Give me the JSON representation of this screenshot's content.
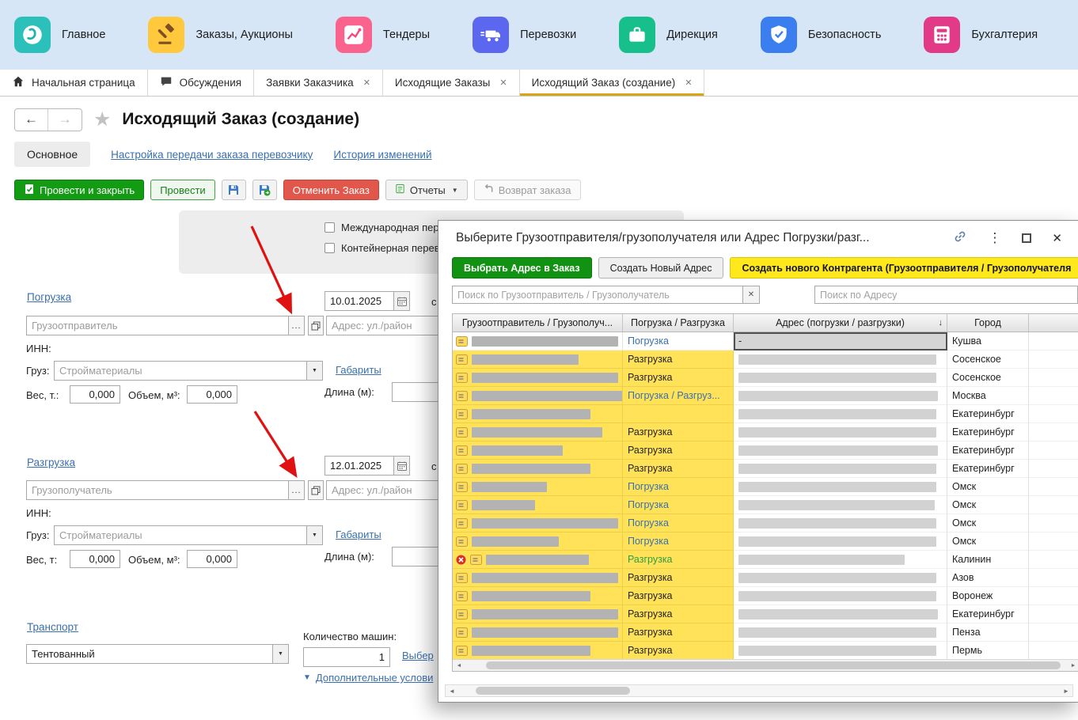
{
  "nav": {
    "items": [
      {
        "label": "Главное"
      },
      {
        "label": "Заказы, Аукционы"
      },
      {
        "label": "Тендеры"
      },
      {
        "label": "Перевозки"
      },
      {
        "label": "Дирекция"
      },
      {
        "label": "Безопасность"
      },
      {
        "label": "Бухгалтерия"
      }
    ]
  },
  "tabs": {
    "home": "Начальная страница",
    "discussions": "Обсуждения",
    "requests": "Заявки Заказчика",
    "outgoing": "Исходящие Заказы",
    "current": "Исходящий Заказ (создание)"
  },
  "page": {
    "title": "Исходящий Заказ (создание)"
  },
  "subtabs": {
    "main": "Основное",
    "transfer": "Настройка передачи заказа перевозчику",
    "history": "История изменений"
  },
  "toolbar": {
    "post_close": "Провести и закрыть",
    "post": "Провести",
    "cancel": "Отменить Заказ",
    "reports": "Отчеты",
    "return_order": "Возврат заказа"
  },
  "form": {
    "intl_checkbox": "Международная пер",
    "container_checkbox": "Контейнерная перев",
    "loading": {
      "title": "Погрузка",
      "date": "10.01.2025",
      "from": "с",
      "party_ph": "Грузоотправитель",
      "addr_ph": "Адрес: ул./район",
      "inn": "ИНН:",
      "cargo": "Груз:",
      "cargo_ph": "Стройматериалы",
      "dims": "Габариты",
      "len": "Длина (м):",
      "weight_l": "Вес, т.:",
      "weight": "0,000",
      "vol_l": "Объем, м³:",
      "vol": "0,000"
    },
    "unloading": {
      "title": "Разгрузка",
      "date": "12.01.2025",
      "from": "с",
      "party_ph": "Грузополучатель",
      "addr_ph": "Адрес: ул./район",
      "inn": "ИНН:",
      "cargo": "Груз:",
      "cargo_ph": "Стройматериалы",
      "dims": "Габариты",
      "len": "Длина (м):",
      "weight_l": "Вес, т:",
      "weight": "0,000",
      "vol_l": "Объем, м³:",
      "vol": "0,000"
    },
    "transport": {
      "title": "Транспорт",
      "value": "Тентованный",
      "qty_l": "Количество машин:",
      "qty": "1",
      "select": "Выбер",
      "more": "Дополнительные услови"
    }
  },
  "dialog": {
    "title": "Выберите Грузоотправителя/грузополучателя или Адрес Погрузки/разг...",
    "select_btn": "Выбрать Адрес в Заказ",
    "new_addr_btn": "Создать Новый Адрес",
    "new_party_btn": "Создать нового Контрагента (Грузоотправителя / Грузополучателя",
    "search_party_ph": "Поиск по Грузоотправитель / Грузополучатель",
    "search_addr_ph": "Поиск по Адресу",
    "columns": [
      "Грузоотправитель / Грузополуч...",
      "Погрузка / Разгрузка",
      "Адрес (погрузки / разгрузки)",
      "Город"
    ],
    "rows": [
      {
        "type": "Погрузка",
        "tstyle": "link",
        "city": "Кушва",
        "nw": 185,
        "aw": 0,
        "atext": "-",
        "yellow": false,
        "selcell": true,
        "del": false
      },
      {
        "type": "Разгрузка",
        "tstyle": "plain",
        "city": "Сосенское",
        "nw": 135,
        "aw": 250,
        "yellow": true,
        "del": false
      },
      {
        "type": "Разгрузка",
        "tstyle": "plain",
        "city": "Сосенское",
        "nw": 185,
        "aw": 250,
        "yellow": true,
        "del": false
      },
      {
        "type": "Погрузка / Разгруз...",
        "tstyle": "link",
        "city": "Москва",
        "nw": 205,
        "aw": 252,
        "yellow": true,
        "del": false
      },
      {
        "type": "",
        "tstyle": "plain",
        "city": "Екатеринбург",
        "nw": 150,
        "aw": 250,
        "yellow": true,
        "del": false
      },
      {
        "type": "Разгрузка",
        "tstyle": "plain",
        "city": "Екатеринбург",
        "nw": 165,
        "aw": 250,
        "yellow": true,
        "del": false
      },
      {
        "type": "Разгрузка",
        "tstyle": "plain",
        "city": "Екатеринбург",
        "nw": 115,
        "aw": 252,
        "yellow": true,
        "del": false
      },
      {
        "type": "Разгрузка",
        "tstyle": "plain",
        "city": "Екатеринбург",
        "nw": 150,
        "aw": 250,
        "yellow": true,
        "del": false
      },
      {
        "type": "Погрузка",
        "tstyle": "link",
        "city": "Омск",
        "nw": 95,
        "aw": 250,
        "yellow": true,
        "del": false
      },
      {
        "type": "Погрузка",
        "tstyle": "link",
        "city": "Омск",
        "nw": 80,
        "aw": 248,
        "yellow": true,
        "del": false
      },
      {
        "type": "Погрузка",
        "tstyle": "link",
        "city": "Омск",
        "nw": 185,
        "aw": 250,
        "yellow": true,
        "del": false
      },
      {
        "type": "Погрузка",
        "tstyle": "link",
        "city": "Омск",
        "nw": 110,
        "aw": 250,
        "yellow": true,
        "del": false
      },
      {
        "type": "Разгрузка",
        "tstyle": "green",
        "city": "Калинин",
        "nw": 130,
        "aw": 210,
        "yellow": true,
        "del": true
      },
      {
        "type": "Разгрузка",
        "tstyle": "plain",
        "city": "Азов",
        "nw": 185,
        "aw": 250,
        "yellow": true,
        "del": false
      },
      {
        "type": "Разгрузка",
        "tstyle": "plain",
        "city": "Воронеж",
        "nw": 150,
        "aw": 250,
        "yellow": true,
        "del": false
      },
      {
        "type": "Разгрузка",
        "tstyle": "plain",
        "city": "Екатеринбург",
        "nw": 185,
        "aw": 252,
        "yellow": true,
        "del": false
      },
      {
        "type": "Разгрузка",
        "tstyle": "plain",
        "city": "Пенза",
        "nw": 185,
        "aw": 250,
        "yellow": true,
        "del": false
      },
      {
        "type": "Разгрузка",
        "tstyle": "plain",
        "city": "Пермь",
        "nw": 150,
        "aw": 250,
        "yellow": true,
        "del": false
      }
    ]
  },
  "icons": {
    "back": "←",
    "forward": "→",
    "star": "★",
    "close_tab": "✕",
    "dropdown": "▼",
    "ellipsis": "...",
    "dots": "⋮",
    "close": "✕",
    "sort": "↓",
    "collapse": "▼",
    "scroll_left": "◄",
    "scroll_right": "►",
    "clear": "✕"
  },
  "colors": {
    "row_highlight": "#ffe257",
    "primary_green": "#149b14",
    "cancel_red": "#e2574b",
    "create_party_yellow": "#ffe91c",
    "link_blue": "#3a6fb0",
    "active_tab_underline": "#d9a514"
  }
}
